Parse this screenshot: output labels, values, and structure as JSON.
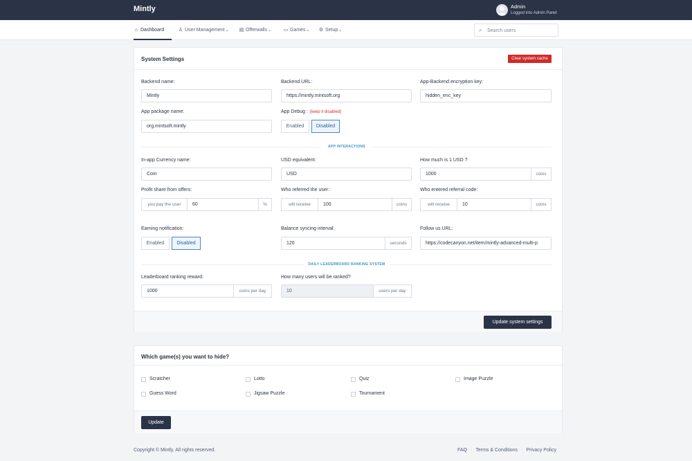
{
  "app": {
    "brand": "Mintly"
  },
  "user": {
    "name": "Admin",
    "subtitle": "Logged into Admin Panel"
  },
  "nav": {
    "items": [
      {
        "label": "Dashboard",
        "icon": "home-icon",
        "active": true
      },
      {
        "label": "User Management",
        "icon": "user-icon",
        "chevron": true
      },
      {
        "label": "Offerwalls",
        "icon": "offerwall-icon",
        "chevron": true
      },
      {
        "label": "Games",
        "icon": "gamepad-icon",
        "chevron": true
      },
      {
        "label": "Setup",
        "icon": "gear-icon",
        "chevron": true
      }
    ],
    "search_placeholder": "Search users"
  },
  "settings": {
    "title": "System Settings",
    "clear_cache_label": "Clear system cache",
    "backend_name_label": "Backend name:",
    "backend_name_value": "Mintly",
    "backend_url_label": "Backend URL:",
    "backend_url_value": "https://mintly.mintsoft.org",
    "enc_key_label": "App-Backend encryption key:",
    "enc_key_value": "hidden_enc_key",
    "package_label": "App package name:",
    "package_value": "org.mintsoft.mintly",
    "debug_label": "App Debug :",
    "debug_note": "[keep it disabled]",
    "debug_enabled": "Enabled",
    "debug_disabled": "Disabled",
    "section_app": "APP INTERACTIONS",
    "currency_label": "In-app Currency name:",
    "currency_value": "Coin",
    "usd_equiv_label": "USD equivalent:",
    "usd_equiv_value": "USD",
    "how_much_label": "How much is 1 USD ?",
    "how_much_value": "1000",
    "how_much_unit": "coins",
    "profit_label": "Profit share from offers:",
    "profit_prefix": "you pay the user",
    "profit_value": "60",
    "profit_unit": "%",
    "referred_label": "Who referred the user:",
    "referred_prefix": "will receive",
    "referred_value": "100",
    "referred_unit": "coins",
    "entered_label": "Who entered referral code:",
    "entered_prefix": "will receive",
    "entered_value": "10",
    "entered_unit": "coins",
    "earning_label": "Earning notification:",
    "earning_enabled": "Enabled",
    "earning_disabled": "Disabled",
    "sync_label": "Balance syncing interval:",
    "sync_value": "120",
    "sync_unit": "seconds",
    "follow_label": "Follow us URL:",
    "follow_value": "https://codecanyon.net/item/mintly-advanced-multi-p",
    "section_leaderboard": "DAILY LEADERBOARD RANKING SYSTEM",
    "reward_label": "Leaderboard ranking reward:",
    "reward_value": "1000",
    "reward_unit": "coins per day",
    "ranked_label": "How many users will be ranked?",
    "ranked_value": "10",
    "ranked_unit": "users per day",
    "update_label": "Update system settings"
  },
  "games": {
    "title": "Which game(s) you want to hide?",
    "options": [
      "Scratcher",
      "Lotto",
      "Quiz",
      "Image Puzzle",
      "Guess Word",
      "Jigsaw Puzzle",
      "Tournament"
    ],
    "update_label": "Update"
  },
  "footer": {
    "copyright": "Copyright © Mintly. All rights reserved.",
    "links": [
      "FAQ",
      "Terms & Conditions",
      "Privacy Policy"
    ]
  },
  "colors": {
    "topbar": "#2b3447",
    "danger": "#d12a2a",
    "accent": "#3a8fc7"
  }
}
